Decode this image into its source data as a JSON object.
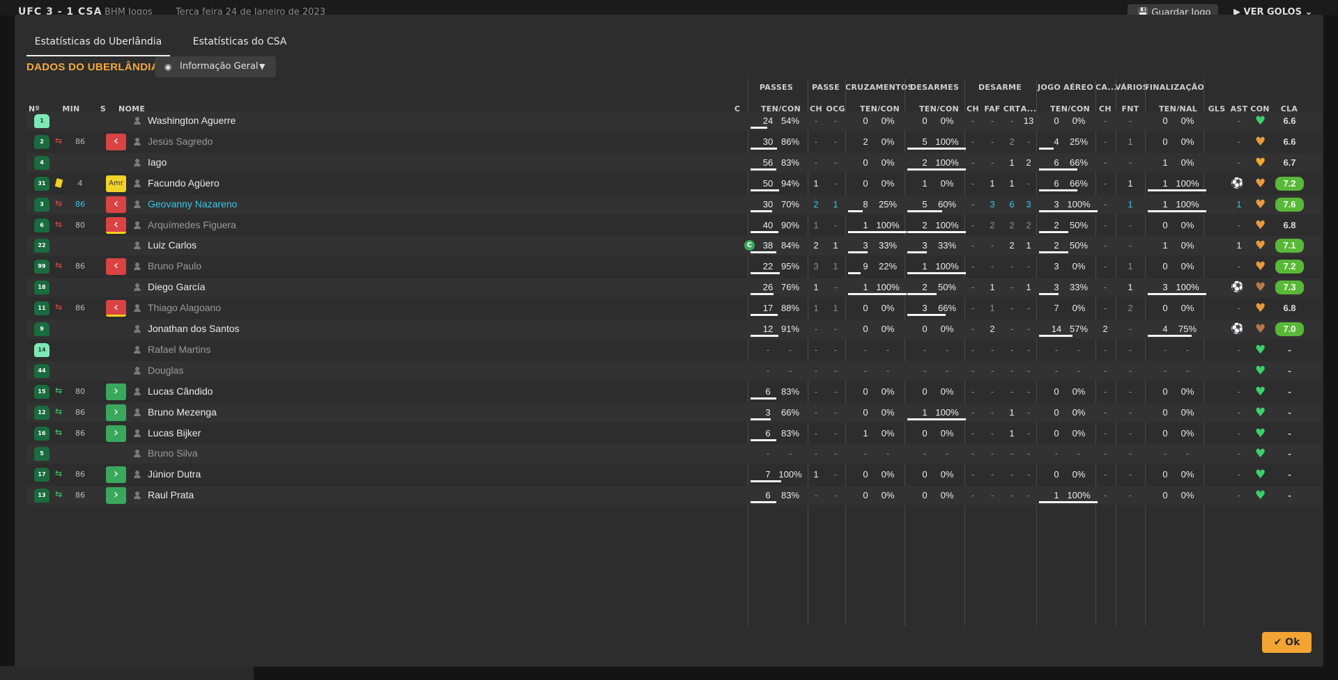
{
  "topbar": {
    "score_line": "UFC 3 - 1 CSA",
    "competition": "BHM Jogos",
    "date": "Terça feira 24 de Janeiro de 2023",
    "save_label": "💾 Guardar Jogo",
    "goals_label": "▶ VER GOLOS ⌄"
  },
  "tabs": [
    "Estatísticas do Uberlândia",
    "Estatísticas do CSA"
  ],
  "team_title": "DADOS DO UBERLÂNDIA",
  "view_dropdown": {
    "label": "Informação Geral",
    "icon": "eye-icon"
  },
  "group_headers": [
    "PASSES",
    "PASSE",
    "CRUZAMENTOS",
    "DESARMES",
    "DESARME",
    "JOGO AÉREO",
    "CA...",
    "VÁRIOS",
    "FINALIZAÇÃO"
  ],
  "sub_headers": [
    "Nº",
    "MIN",
    "S",
    "NOME",
    "C",
    "TEN/CON",
    "CH",
    "OCG",
    "TEN/CON",
    "TEN/CON",
    "CH",
    "FAF",
    "CRT",
    "A...",
    "TEN/CON",
    "CH",
    "FNT",
    "TEN/NAL",
    "GLS",
    "AST",
    "CON",
    "CLA"
  ],
  "ok_label": "✔ Ok",
  "colors": {
    "accent": "#f3a93c",
    "rating_green": "#59b838",
    "sub_off": "#d94343",
    "sub_on": "#3aa85c",
    "link": "#35c6e8"
  },
  "players": [
    {
      "num": "1",
      "gk": true,
      "name": "Washington Aguerre",
      "pass": [
        "24",
        "54%",
        0.54
      ],
      "ch": "-",
      "ocg": "-",
      "cruz": [
        "0",
        "0%",
        0
      ],
      "des": [
        "0",
        "0%",
        0
      ],
      "d": [
        "-",
        "-",
        "-",
        "13"
      ],
      "aer": [
        "0",
        "0%",
        0
      ],
      "ca": "-",
      "fnt": "-",
      "fin": [
        "0",
        "0%",
        0
      ],
      "gls": "",
      "ast": "-",
      "con": "green",
      "cla": "6.6"
    },
    {
      "num": "2",
      "sub": "off",
      "min": "86",
      "badge": "red",
      "dim": true,
      "name": "Jesús Sagredo",
      "pass": [
        "30",
        "86%",
        0.86
      ],
      "ch": "-",
      "ocg": "-",
      "cruz": [
        "2",
        "0%",
        0
      ],
      "des": [
        "5",
        "100%",
        1
      ],
      "d": [
        "-",
        "-",
        "2",
        "-"
      ],
      "aer": [
        "4",
        "25%",
        0.25
      ],
      "ca": "-",
      "fnt": "1",
      "fin": [
        "0",
        "0%",
        0
      ],
      "gls": "",
      "ast": "-",
      "con": "mixed",
      "cla": "6.6"
    },
    {
      "num": "4",
      "name": "Iago",
      "pass": [
        "56",
        "83%",
        0.83
      ],
      "ch": "-",
      "ocg": "-",
      "cruz": [
        "0",
        "0%",
        0
      ],
      "des": [
        "2",
        "100%",
        1
      ],
      "d": [
        "-",
        "-",
        "1",
        "2"
      ],
      "aer": [
        "6",
        "66%",
        0.66
      ],
      "ca": "-",
      "fnt": "-",
      "fin": [
        "1",
        "0%",
        0
      ],
      "gls": "",
      "ast": "-",
      "con": "gold",
      "cla": "6.7"
    },
    {
      "num": "31",
      "card": "yellow",
      "min": "4",
      "badge": "amr",
      "name": "Facundo Agüero",
      "pass": [
        "50",
        "94%",
        0.94
      ],
      "ch": "1",
      "ocg": "-",
      "cruz": [
        "0",
        "0%",
        0
      ],
      "des": [
        "1",
        "0%",
        0
      ],
      "d": [
        "-",
        "1",
        "1",
        "-"
      ],
      "aer": [
        "6",
        "66%",
        0.66
      ],
      "ca": "-",
      "fnt": "1",
      "fin": [
        "1",
        "100%",
        1
      ],
      "gls": "ball",
      "ast": "-",
      "con": "mixed",
      "cla": "7.2",
      "green": true
    },
    {
      "num": "3",
      "sub": "off",
      "min": "86",
      "minblue": true,
      "badge": "red",
      "blue": true,
      "name": "Geovanny Nazareno",
      "pass": [
        "30",
        "70%",
        0.7
      ],
      "ch": "2",
      "ocg": "1",
      "cruz": [
        "8",
        "25%",
        0.25
      ],
      "des": [
        "5",
        "60%",
        0.6
      ],
      "d": [
        "-",
        "3",
        "6",
        "3"
      ],
      "aer": [
        "3",
        "100%",
        1
      ],
      "ca": "-",
      "fnt": "1",
      "fin": [
        "1",
        "100%",
        1
      ],
      "gls": "",
      "ast": "1",
      "con": "mixed",
      "cla": "7.6",
      "green": true
    },
    {
      "num": "6",
      "sub": "off",
      "min": "80",
      "badge": "redy",
      "dim": true,
      "name": "Arquímedes Figuera",
      "pass": [
        "40",
        "90%",
        0.9
      ],
      "ch": "1",
      "ocg": "-",
      "cruz": [
        "1",
        "100%",
        1
      ],
      "des": [
        "2",
        "100%",
        1
      ],
      "d": [
        "-",
        "2",
        "2",
        "2"
      ],
      "aer": [
        "2",
        "50%",
        0.5
      ],
      "ca": "-",
      "fnt": "-",
      "fin": [
        "0",
        "0%",
        0
      ],
      "gls": "",
      "ast": "-",
      "con": "mixed",
      "cla": "6.8"
    },
    {
      "num": "22",
      "captain": true,
      "name": "Luiz Carlos",
      "pass": [
        "38",
        "84%",
        0.84
      ],
      "ch": "2",
      "ocg": "1",
      "cruz": [
        "3",
        "33%",
        0.33
      ],
      "des": [
        "3",
        "33%",
        0.33
      ],
      "d": [
        "-",
        "-",
        "2",
        "1"
      ],
      "aer": [
        "2",
        "50%",
        0.5
      ],
      "ca": "-",
      "fnt": "-",
      "fin": [
        "1",
        "0%",
        0
      ],
      "gls": "",
      "ast": "1",
      "con": "mixed",
      "cla": "7.1",
      "green": true
    },
    {
      "num": "99",
      "sub": "off",
      "min": "86",
      "badge": "red",
      "dim": true,
      "name": "Bruno Paulo",
      "pass": [
        "22",
        "95%",
        0.95
      ],
      "ch": "3",
      "ocg": "1",
      "cruz": [
        "9",
        "22%",
        0.22
      ],
      "des": [
        "1",
        "100%",
        1
      ],
      "d": [
        "-",
        "-",
        "-",
        "-"
      ],
      "aer": [
        "3",
        "0%",
        0
      ],
      "ca": "-",
      "fnt": "1",
      "fin": [
        "0",
        "0%",
        0
      ],
      "gls": "",
      "ast": "-",
      "con": "mixed",
      "cla": "7.2",
      "green": true
    },
    {
      "num": "18",
      "name": "Diego García",
      "pass": [
        "26",
        "76%",
        0.76
      ],
      "ch": "1",
      "ocg": "-",
      "cruz": [
        "1",
        "100%",
        1
      ],
      "des": [
        "2",
        "50%",
        0.5
      ],
      "d": [
        "-",
        "1",
        "-",
        "1"
      ],
      "aer": [
        "3",
        "33%",
        0.33
      ],
      "ca": "-",
      "fnt": "1",
      "fin": [
        "3",
        "100%",
        1
      ],
      "gls": "ball",
      "ast": "-",
      "con": "brown",
      "cla": "7.3",
      "green": true
    },
    {
      "num": "11",
      "sub": "off",
      "min": "86",
      "badge": "redy",
      "dim": true,
      "name": "Thiago Alagoano",
      "pass": [
        "17",
        "88%",
        0.88
      ],
      "ch": "1",
      "ocg": "1",
      "cruz": [
        "0",
        "0%",
        0
      ],
      "des": [
        "3",
        "66%",
        0.66
      ],
      "d": [
        "-",
        "1",
        "-",
        "-"
      ],
      "aer": [
        "7",
        "0%",
        0
      ],
      "ca": "-",
      "fnt": "2",
      "fin": [
        "0",
        "0%",
        0
      ],
      "gls": "",
      "ast": "-",
      "con": "mixed",
      "cla": "6.8"
    },
    {
      "num": "9",
      "name": "Jonathan dos Santos",
      "pass": [
        "12",
        "91%",
        0.91
      ],
      "ch": "-",
      "ocg": "-",
      "cruz": [
        "0",
        "0%",
        0
      ],
      "des": [
        "0",
        "0%",
        0
      ],
      "d": [
        "-",
        "2",
        "-",
        "-"
      ],
      "aer": [
        "14",
        "57%",
        0.57
      ],
      "ca": "2",
      "fnt": "-",
      "fin": [
        "4",
        "75%",
        0.75
      ],
      "gls": "ball",
      "ast": "-",
      "con": "brown",
      "cla": "7.0",
      "green": true
    },
    {
      "num": "14",
      "gk": true,
      "dim": true,
      "name": "Rafael Martins",
      "pass": [
        "-",
        "-",
        0
      ],
      "ch": "-",
      "ocg": "-",
      "cruz": [
        "-",
        "-",
        0
      ],
      "des": [
        "-",
        "-",
        0
      ],
      "d": [
        "-",
        "-",
        "-",
        "-"
      ],
      "aer": [
        "-",
        "-",
        0
      ],
      "ca": "-",
      "fnt": "-",
      "fin": [
        "-",
        "-",
        0
      ],
      "gls": "",
      "ast": "-",
      "con": "green",
      "cla": "-"
    },
    {
      "num": "44",
      "dim": true,
      "name": "Douglas",
      "pass": [
        "-",
        "-",
        0
      ],
      "ch": "-",
      "ocg": "-",
      "cruz": [
        "-",
        "-",
        0
      ],
      "des": [
        "-",
        "-",
        0
      ],
      "d": [
        "-",
        "-",
        "-",
        "-"
      ],
      "aer": [
        "-",
        "-",
        0
      ],
      "ca": "-",
      "fnt": "-",
      "fin": [
        "-",
        "-",
        0
      ],
      "gls": "",
      "ast": "-",
      "con": "green",
      "cla": "-"
    },
    {
      "num": "15",
      "sub": "on",
      "min": "80",
      "badge": "green",
      "name": "Lucas Cândido",
      "pass": [
        "6",
        "83%",
        0.83
      ],
      "ch": "-",
      "ocg": "-",
      "cruz": [
        "0",
        "0%",
        0
      ],
      "des": [
        "0",
        "0%",
        0
      ],
      "d": [
        "-",
        "-",
        "-",
        "-"
      ],
      "aer": [
        "0",
        "0%",
        0
      ],
      "ca": "-",
      "fnt": "-",
      "fin": [
        "0",
        "0%",
        0
      ],
      "gls": "",
      "ast": "-",
      "con": "green",
      "cla": "-"
    },
    {
      "num": "12",
      "sub": "on",
      "min": "86",
      "badge": "green",
      "name": "Bruno Mezenga",
      "pass": [
        "3",
        "66%",
        0.66
      ],
      "ch": "-",
      "ocg": "-",
      "cruz": [
        "0",
        "0%",
        0
      ],
      "des": [
        "1",
        "100%",
        1
      ],
      "d": [
        "-",
        "-",
        "1",
        "-"
      ],
      "aer": [
        "0",
        "0%",
        0
      ],
      "ca": "-",
      "fnt": "-",
      "fin": [
        "0",
        "0%",
        0
      ],
      "gls": "",
      "ast": "-",
      "con": "green",
      "cla": "-"
    },
    {
      "num": "16",
      "sub": "on",
      "min": "86",
      "badge": "green",
      "name": "Lucas Bijker",
      "pass": [
        "6",
        "83%",
        0.83
      ],
      "ch": "-",
      "ocg": "-",
      "cruz": [
        "1",
        "0%",
        0
      ],
      "des": [
        "0",
        "0%",
        0
      ],
      "d": [
        "-",
        "-",
        "1",
        "-"
      ],
      "aer": [
        "0",
        "0%",
        0
      ],
      "ca": "-",
      "fnt": "-",
      "fin": [
        "0",
        "0%",
        0
      ],
      "gls": "",
      "ast": "-",
      "con": "green",
      "cla": "-"
    },
    {
      "num": "5",
      "dim": true,
      "name": "Bruno Silva",
      "pass": [
        "-",
        "-",
        0
      ],
      "ch": "-",
      "ocg": "-",
      "cruz": [
        "-",
        "-",
        0
      ],
      "des": [
        "-",
        "-",
        0
      ],
      "d": [
        "-",
        "-",
        "-",
        "-"
      ],
      "aer": [
        "-",
        "-",
        0
      ],
      "ca": "-",
      "fnt": "-",
      "fin": [
        "-",
        "-",
        0
      ],
      "gls": "",
      "ast": "-",
      "con": "green",
      "cla": "-"
    },
    {
      "num": "17",
      "sub": "on",
      "min": "86",
      "badge": "green",
      "name": "Júnior Dutra",
      "pass": [
        "7",
        "100%",
        1
      ],
      "ch": "1",
      "ocg": "-",
      "cruz": [
        "0",
        "0%",
        0
      ],
      "des": [
        "0",
        "0%",
        0
      ],
      "d": [
        "-",
        "-",
        "-",
        "-"
      ],
      "aer": [
        "0",
        "0%",
        0
      ],
      "ca": "-",
      "fnt": "-",
      "fin": [
        "0",
        "0%",
        0
      ],
      "gls": "",
      "ast": "-",
      "con": "green",
      "cla": "-"
    },
    {
      "num": "13",
      "sub": "on",
      "min": "86",
      "badge": "green",
      "name": "Raul Prata",
      "pass": [
        "6",
        "83%",
        0.83
      ],
      "ch": "-",
      "ocg": "-",
      "cruz": [
        "0",
        "0%",
        0
      ],
      "des": [
        "0",
        "0%",
        0
      ],
      "d": [
        "-",
        "-",
        "-",
        "-"
      ],
      "aer": [
        "1",
        "100%",
        1
      ],
      "ca": "-",
      "fnt": "-",
      "fin": [
        "0",
        "0%",
        0
      ],
      "gls": "",
      "ast": "-",
      "con": "green",
      "cla": "-"
    }
  ]
}
